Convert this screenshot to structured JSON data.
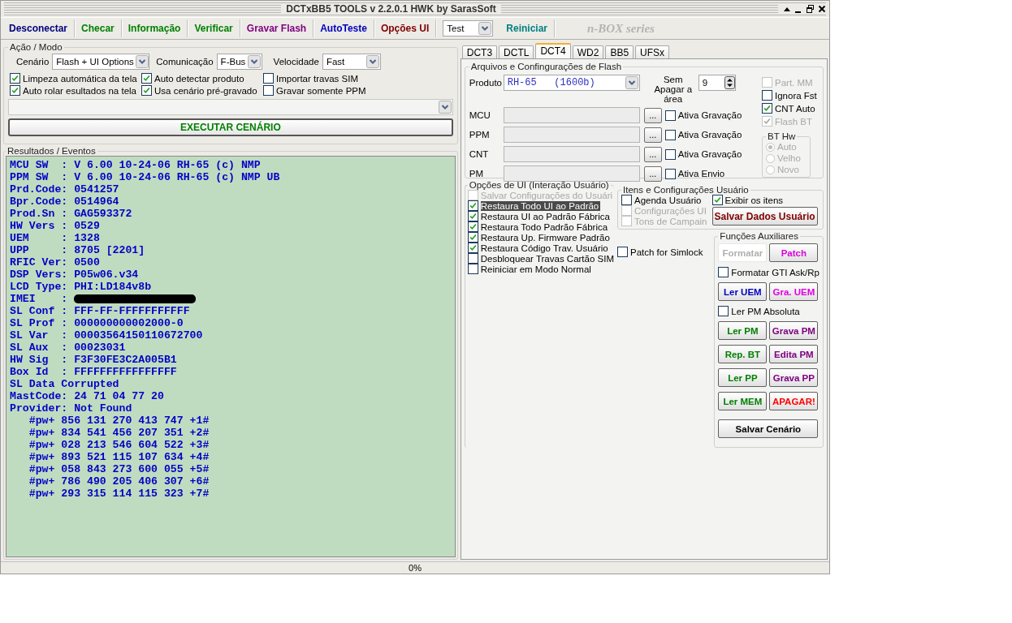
{
  "window": {
    "title": "DCTxBB5 TOOLS v 2.2.0.1 HWK by SarasSoft"
  },
  "toolbar": [
    {
      "kind": "button",
      "label": "Desconectar",
      "color": "#000080"
    },
    {
      "kind": "button",
      "label": "Checar",
      "color": "#008000"
    },
    {
      "kind": "button",
      "label": "Informação",
      "color": "#008000"
    },
    {
      "kind": "button",
      "label": "Verificar",
      "color": "#008000"
    },
    {
      "kind": "button",
      "label": "Gravar Flash",
      "color": "#800080"
    },
    {
      "kind": "button",
      "label": "AutoTeste",
      "color": "#0000c0"
    },
    {
      "kind": "button",
      "label": "Opções UI",
      "color": "#800000"
    },
    {
      "kind": "select",
      "value": "Test"
    },
    {
      "kind": "button",
      "label": "Reiniciar",
      "color": "#008080"
    },
    {
      "kind": "logo",
      "label": "n-BOX series"
    }
  ],
  "action_mode": {
    "title": "Ação / Modo",
    "selects": [
      {
        "label": "Cenário",
        "value": "Flash + UI Options"
      },
      {
        "label": "Comunicação",
        "value": "F-Bus"
      },
      {
        "label": "Velocidade",
        "value": "Fast"
      }
    ],
    "options": [
      {
        "label": "Limpeza automática da tela",
        "checked": true
      },
      {
        "label": "Auto detectar produto",
        "checked": true
      },
      {
        "label": "Importar travas SIM",
        "checked": false
      },
      {
        "label": "Auto rolar esultados na tela",
        "checked": true
      },
      {
        "label": "Usa cenário pré-gravado",
        "checked": true
      },
      {
        "label": "Gravar somente PPM",
        "checked": false
      }
    ],
    "execute_button": "EXECUTAR CENÁRIO"
  },
  "results": {
    "title": "Resultados / Eventos",
    "lines": [
      {
        "kind": "text",
        "text": "MCU SW  : V 6.00 10-24-06 RH-65 (c) NMP"
      },
      {
        "kind": "text",
        "text": "PPM SW  : V 6.00 10-24-06 RH-65 (c) NMP UB"
      },
      {
        "kind": "text",
        "text": "Prd.Code: 0541257"
      },
      {
        "kind": "text",
        "text": "Bpr.Code: 0514964"
      },
      {
        "kind": "text",
        "text": "Prod.Sn : GAG593372"
      },
      {
        "kind": "text",
        "text": "HW Vers : 0529"
      },
      {
        "kind": "text",
        "text": "UEM     : 1328"
      },
      {
        "kind": "text",
        "text": "UPP     : 8705 [2201]"
      },
      {
        "kind": "text",
        "text": "RFIC Ver: 0500"
      },
      {
        "kind": "text",
        "text": "DSP Vers: P05w06.v34"
      },
      {
        "kind": "text",
        "text": "LCD Type: PHI:LD184v8b"
      },
      {
        "kind": "redacted",
        "text": "IMEI    :"
      },
      {
        "kind": "text",
        "text": "SL Conf : FFF-FF-FFFFFFFFFFF"
      },
      {
        "kind": "text",
        "text": "SL Prof : 000000000002000-0"
      },
      {
        "kind": "text",
        "text": "SL Var  : 00003564150110672700"
      },
      {
        "kind": "text",
        "text": "SL Aux  : 00023031"
      },
      {
        "kind": "text",
        "text": "HW Sig  : F3F30FE3C2A005B1"
      },
      {
        "kind": "text",
        "text": "Box Id  : FFFFFFFFFFFFFFFF"
      },
      {
        "kind": "text",
        "text": "SL Data Corrupted"
      },
      {
        "kind": "text",
        "text": "MastCode: 24 71 04 77 20"
      },
      {
        "kind": "text",
        "text": "Provider: Not Found"
      },
      {
        "kind": "text",
        "text": "   #pw+ 856 131 270 413 747 +1#"
      },
      {
        "kind": "text",
        "text": "   #pw+ 834 541 456 207 351 +2#"
      },
      {
        "kind": "text",
        "text": "   #pw+ 028 213 546 604 522 +3#"
      },
      {
        "kind": "text",
        "text": "   #pw+ 893 521 115 107 634 +4#"
      },
      {
        "kind": "text",
        "text": "   #pw+ 058 843 273 600 055 +5#"
      },
      {
        "kind": "text",
        "text": "   #pw+ 786 490 205 406 307 +6#"
      },
      {
        "kind": "text",
        "text": "   #pw+ 293 315 114 115 323 +7#"
      }
    ]
  },
  "tabs": [
    {
      "label": "DCT3",
      "selected": false
    },
    {
      "label": "DCTL",
      "selected": false
    },
    {
      "label": "DCT4",
      "selected": true
    },
    {
      "label": "WD2",
      "selected": false
    },
    {
      "label": "BB5",
      "selected": false
    },
    {
      "label": "UFSx",
      "selected": false
    }
  ],
  "flash_files": {
    "title": "Arquivos e Confingurações de Flash",
    "product": {
      "label": "Produto",
      "value": "RH-65   (1600b)"
    },
    "erase": {
      "label": "Sem Apagar a área",
      "value": "9"
    },
    "files": [
      {
        "label": "MCU",
        "browse": "...",
        "option": "Ativa Gravação",
        "checked": false
      },
      {
        "label": "PPM",
        "browse": "...",
        "option": "Ativa Gravação",
        "checked": false
      },
      {
        "label": "CNT",
        "browse": "...",
        "option": "Ativa Gravação",
        "checked": false
      },
      {
        "label": "PM",
        "browse": "...",
        "option": "Ativa Envio",
        "checked": false
      }
    ],
    "flags": [
      {
        "label": "Part. MM",
        "checked": false,
        "disabled": true
      },
      {
        "label": "Ignora Fst",
        "checked": false,
        "disabled": false
      },
      {
        "label": "CNT Auto",
        "checked": true,
        "disabled": false
      },
      {
        "label": "Flash BT",
        "checked": true,
        "disabled": true
      }
    ],
    "bt_hw": {
      "title": "BT Hw",
      "options": [
        {
          "label": "Auto",
          "selected": true,
          "disabled": true
        },
        {
          "label": "Velho",
          "selected": false,
          "disabled": true
        },
        {
          "label": "Novo",
          "selected": false,
          "disabled": true
        }
      ]
    }
  },
  "ui_options": {
    "title": "Opções de UI (Interação Usuário)",
    "items": [
      {
        "label": "Salvar Configurações do Usuári",
        "checked": false,
        "disabled": true,
        "selected": false
      },
      {
        "label": "Restaura Todo UI ao Padrão",
        "checked": true,
        "disabled": false,
        "selected": true
      },
      {
        "label": "Restaura UI ao Padrão Fábrica",
        "checked": true,
        "disabled": false,
        "selected": false
      },
      {
        "label": "Restaura Todo Padrão Fábrica",
        "checked": true,
        "disabled": false,
        "selected": false
      },
      {
        "label": "Restaura Up. Firmware Padrão",
        "checked": true,
        "disabled": false,
        "selected": false
      },
      {
        "label": "Restaura Código Trav. Usuário",
        "checked": true,
        "disabled": false,
        "selected": false
      },
      {
        "label": "Desbloquear Travas Cartão SIM",
        "checked": false,
        "disabled": false,
        "selected": false
      },
      {
        "label": "Reiniciar em Modo Normal",
        "checked": false,
        "disabled": false,
        "selected": false
      }
    ],
    "patch_simlock": {
      "label": "Patch for Simlock",
      "checked": false
    }
  },
  "user_items": {
    "title": "Itens e Configurações Usuário",
    "items": [
      {
        "label": "Agenda Usuário",
        "checked": false,
        "disabled": false
      },
      {
        "label": "Configurações UI",
        "checked": false,
        "disabled": true
      },
      {
        "label": "Tons de Campain",
        "checked": false,
        "disabled": true
      }
    ],
    "show_items": {
      "label": "Exibir os itens",
      "checked": true
    },
    "save_button": {
      "label": "Salvar Dados Usuário",
      "color": "#800000"
    }
  },
  "aux_functions": {
    "title": "Funções Auxiliares",
    "rows": [
      {
        "kind": "buttons",
        "buttons": [
          {
            "label": "Formatar",
            "color": "#b0b0b0",
            "disabled": true
          },
          {
            "label": "Patch",
            "color": "#e000e0",
            "disabled": false
          }
        ]
      },
      {
        "kind": "check",
        "label": "Formatar GTI Ask/Rp",
        "checked": false
      },
      {
        "kind": "buttons",
        "buttons": [
          {
            "label": "Ler UEM",
            "color": "#0000c0",
            "disabled": false
          },
          {
            "label": "Gra. UEM",
            "color": "#e000e0",
            "disabled": false
          }
        ]
      },
      {
        "kind": "check",
        "label": "Ler PM Absoluta",
        "checked": false
      },
      {
        "kind": "buttons",
        "buttons": [
          {
            "label": "Ler PM",
            "color": "#008000",
            "disabled": false
          },
          {
            "label": "Grava PM",
            "color": "#800080",
            "disabled": false
          }
        ]
      },
      {
        "kind": "buttons",
        "buttons": [
          {
            "label": "Rep. BT",
            "color": "#008000",
            "disabled": false
          },
          {
            "label": "Edita PM",
            "color": "#800080",
            "disabled": false
          }
        ]
      },
      {
        "kind": "buttons",
        "buttons": [
          {
            "label": "Ler PP",
            "color": "#008000",
            "disabled": false
          },
          {
            "label": "Grava PP",
            "color": "#800080",
            "disabled": false
          }
        ]
      },
      {
        "kind": "buttons",
        "buttons": [
          {
            "label": "Ler MEM",
            "color": "#008000",
            "disabled": false
          },
          {
            "label": "APAGAR!",
            "color": "#ff0000",
            "disabled": false
          }
        ]
      },
      {
        "kind": "wide",
        "buttons": [
          {
            "label": "Salvar Cenário",
            "color": "#000000",
            "disabled": false
          }
        ]
      }
    ]
  },
  "status_bar": {
    "progress": "0%"
  }
}
